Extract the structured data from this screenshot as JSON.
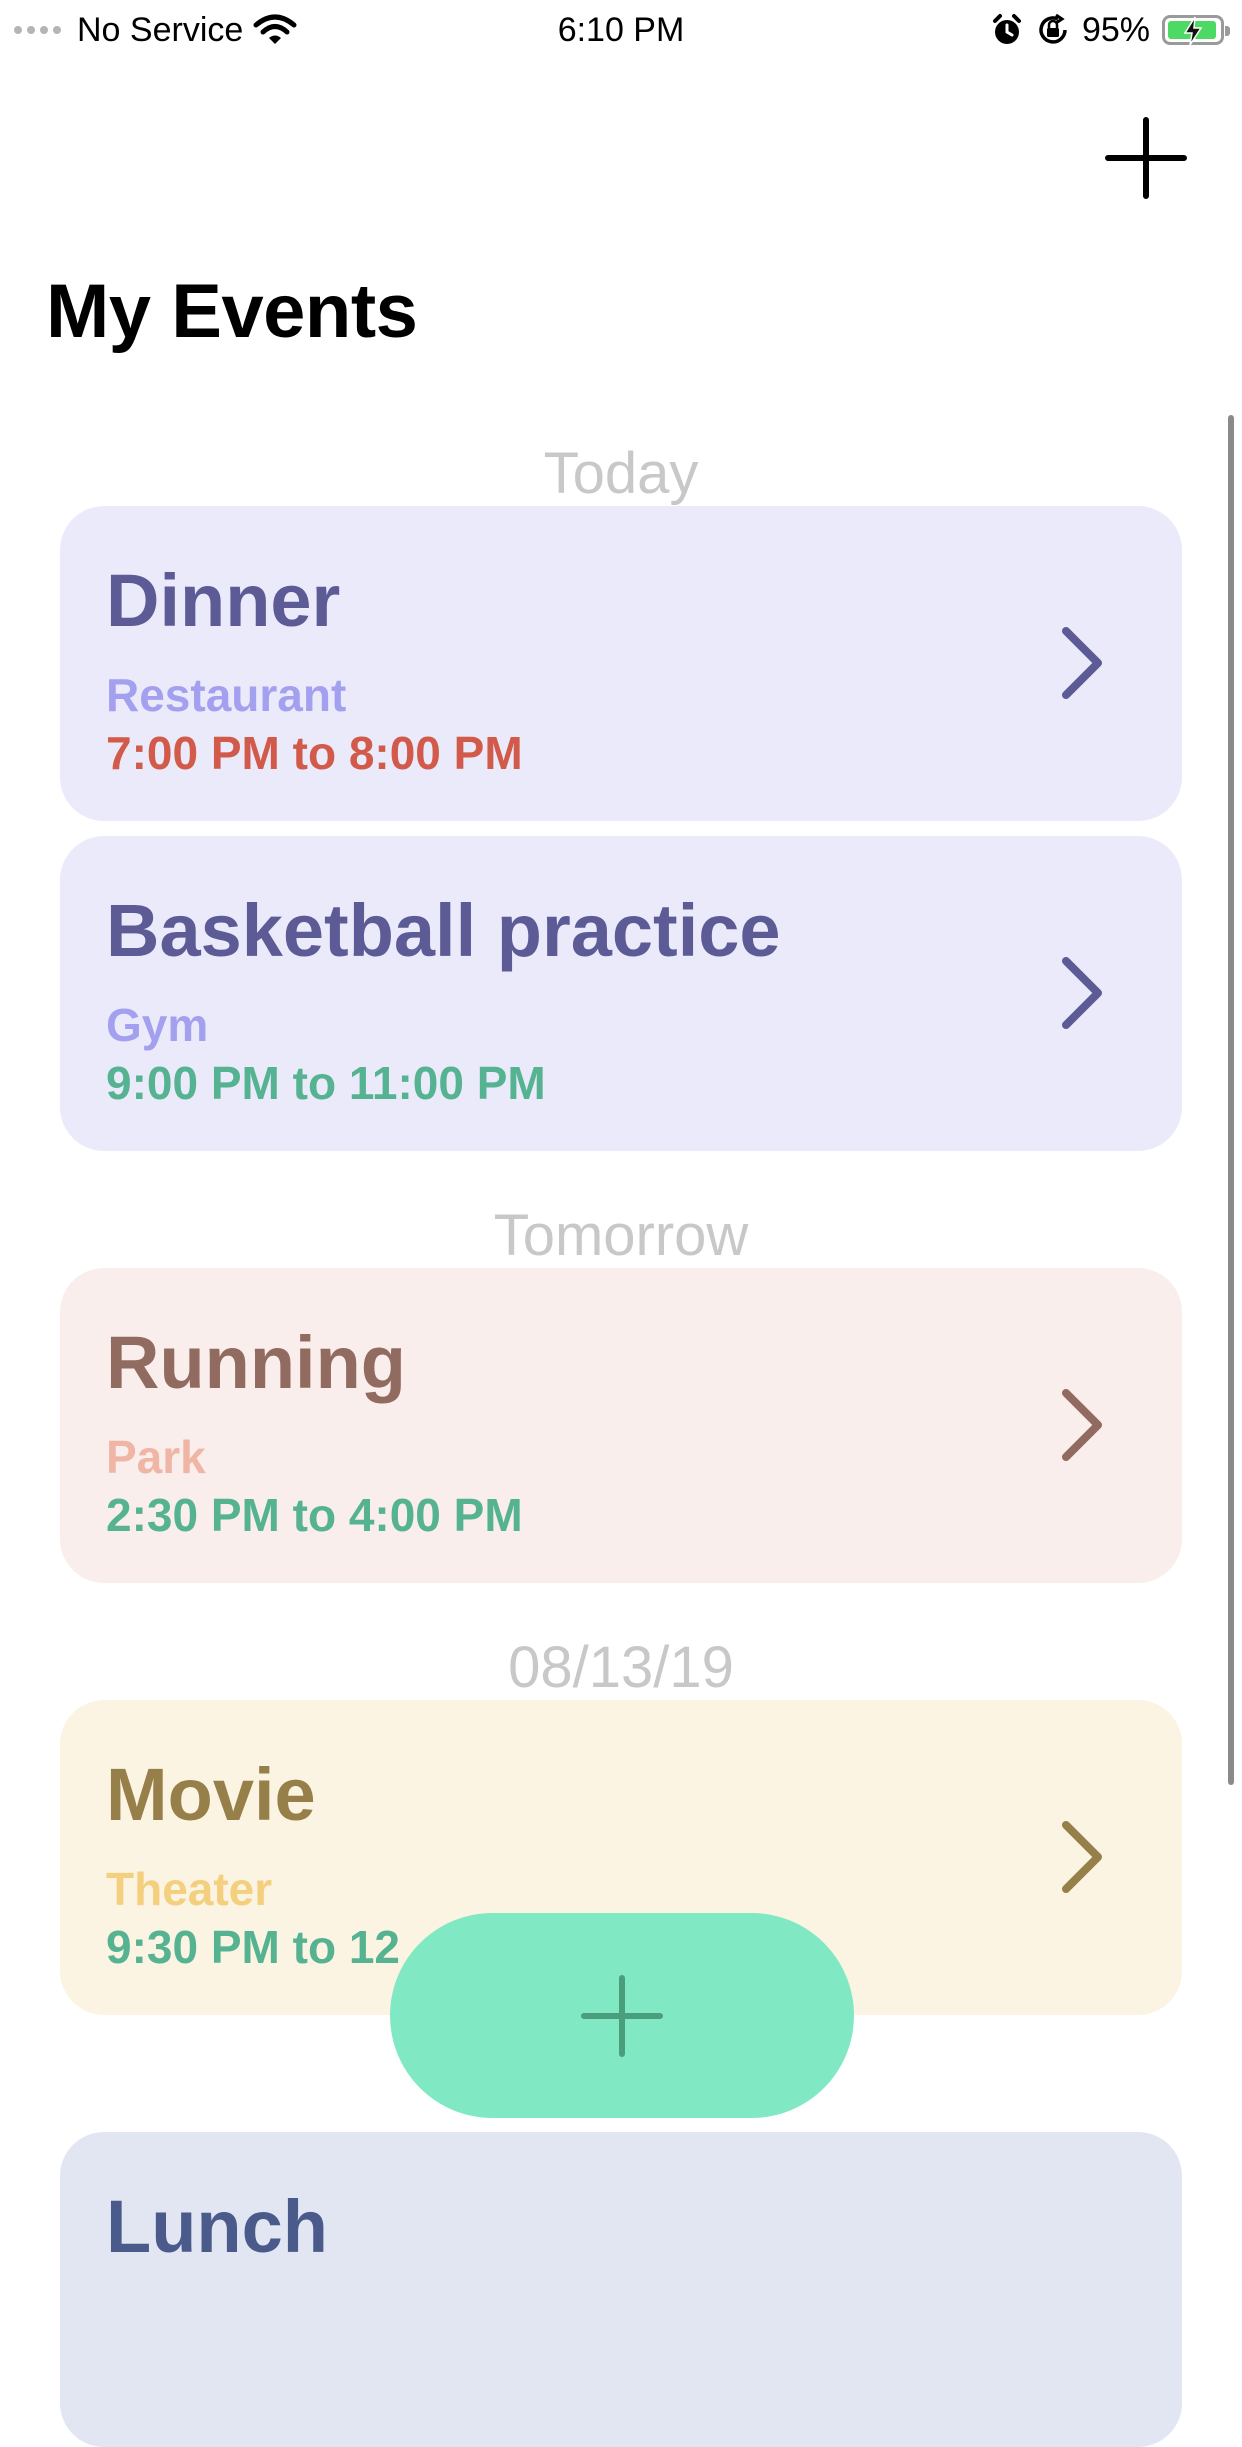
{
  "status_bar": {
    "carrier": "No Service",
    "time": "6:10 PM",
    "battery_percent": "95%",
    "battery_level": 0.95,
    "icons": [
      "signal-dots-icon",
      "wifi-icon",
      "alarm-icon",
      "orientation-lock-icon",
      "battery-charging-icon"
    ]
  },
  "nav": {
    "add_icon": "plus-icon",
    "title": "My Events"
  },
  "sections": [
    {
      "header": "Today",
      "events": [
        {
          "title": "Dinner",
          "location": "Restaurant",
          "time": "7:00 PM to 8:00 PM"
        },
        {
          "title": "Basketball practice",
          "location": "Gym",
          "time": "9:00 PM to 11:00 PM"
        }
      ]
    },
    {
      "header": "Tomorrow",
      "events": [
        {
          "title": "Running",
          "location": "Park",
          "time": "2:30 PM to 4:00 PM"
        }
      ]
    },
    {
      "header": "08/13/19",
      "events": [
        {
          "title": "Movie",
          "location": "Theater",
          "time": "9:30 PM to 12"
        }
      ]
    },
    {
      "events": [
        {
          "title": "Lunch"
        }
      ]
    }
  ],
  "fab": {
    "icon": "plus-icon"
  },
  "colors": {
    "today_card_bg": "#ebeafb",
    "today_title": "#5c5b96",
    "today_location": "#a4a0f0",
    "time_red": "#d15a4a",
    "time_green": "#55b391",
    "tomorrow_card_bg": "#f9eeec",
    "tomorrow_title": "#916a60",
    "tomorrow_location": "#efb5a5",
    "movie_card_bg": "#fbf4e3",
    "movie_title": "#967f48",
    "movie_location": "#f3cf7e",
    "lunch_card_bg": "#e2e6f3",
    "lunch_title": "#4a5a8a",
    "fab_bg": "#80e9c4",
    "fab_icon": "#4a9e7c"
  }
}
